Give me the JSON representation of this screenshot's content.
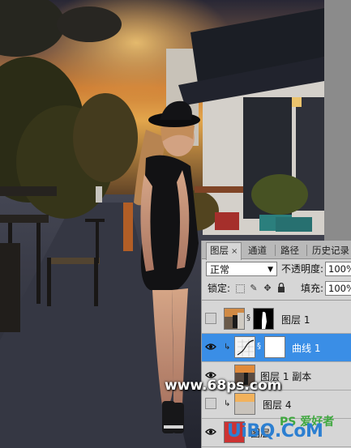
{
  "tabs": [
    {
      "label": "图层",
      "active": true,
      "close": "×"
    },
    {
      "label": "通道",
      "active": false
    },
    {
      "label": "路径",
      "active": false
    },
    {
      "label": "历史记录",
      "active": false
    }
  ],
  "blend_mode": "正常",
  "opacity": {
    "label": "不透明度:",
    "value": "100%"
  },
  "lock": {
    "label": "锁定:"
  },
  "fill": {
    "label": "填充:",
    "value": "100%"
  },
  "layers": [
    {
      "name": "图层 1",
      "visible": false,
      "selected": false
    },
    {
      "name": "曲线 1",
      "visible": true,
      "selected": true
    },
    {
      "name": "图层 1 副本",
      "visible": true,
      "selected": false
    },
    {
      "name": "图层 4",
      "visible": false,
      "selected": false
    },
    {
      "name": "图层",
      "visible": true,
      "selected": false
    }
  ],
  "watermarks": {
    "site": "www.68ps.com",
    "uibq": "UiBQ.CoM",
    "ps_badge": "PS 爱好者"
  }
}
